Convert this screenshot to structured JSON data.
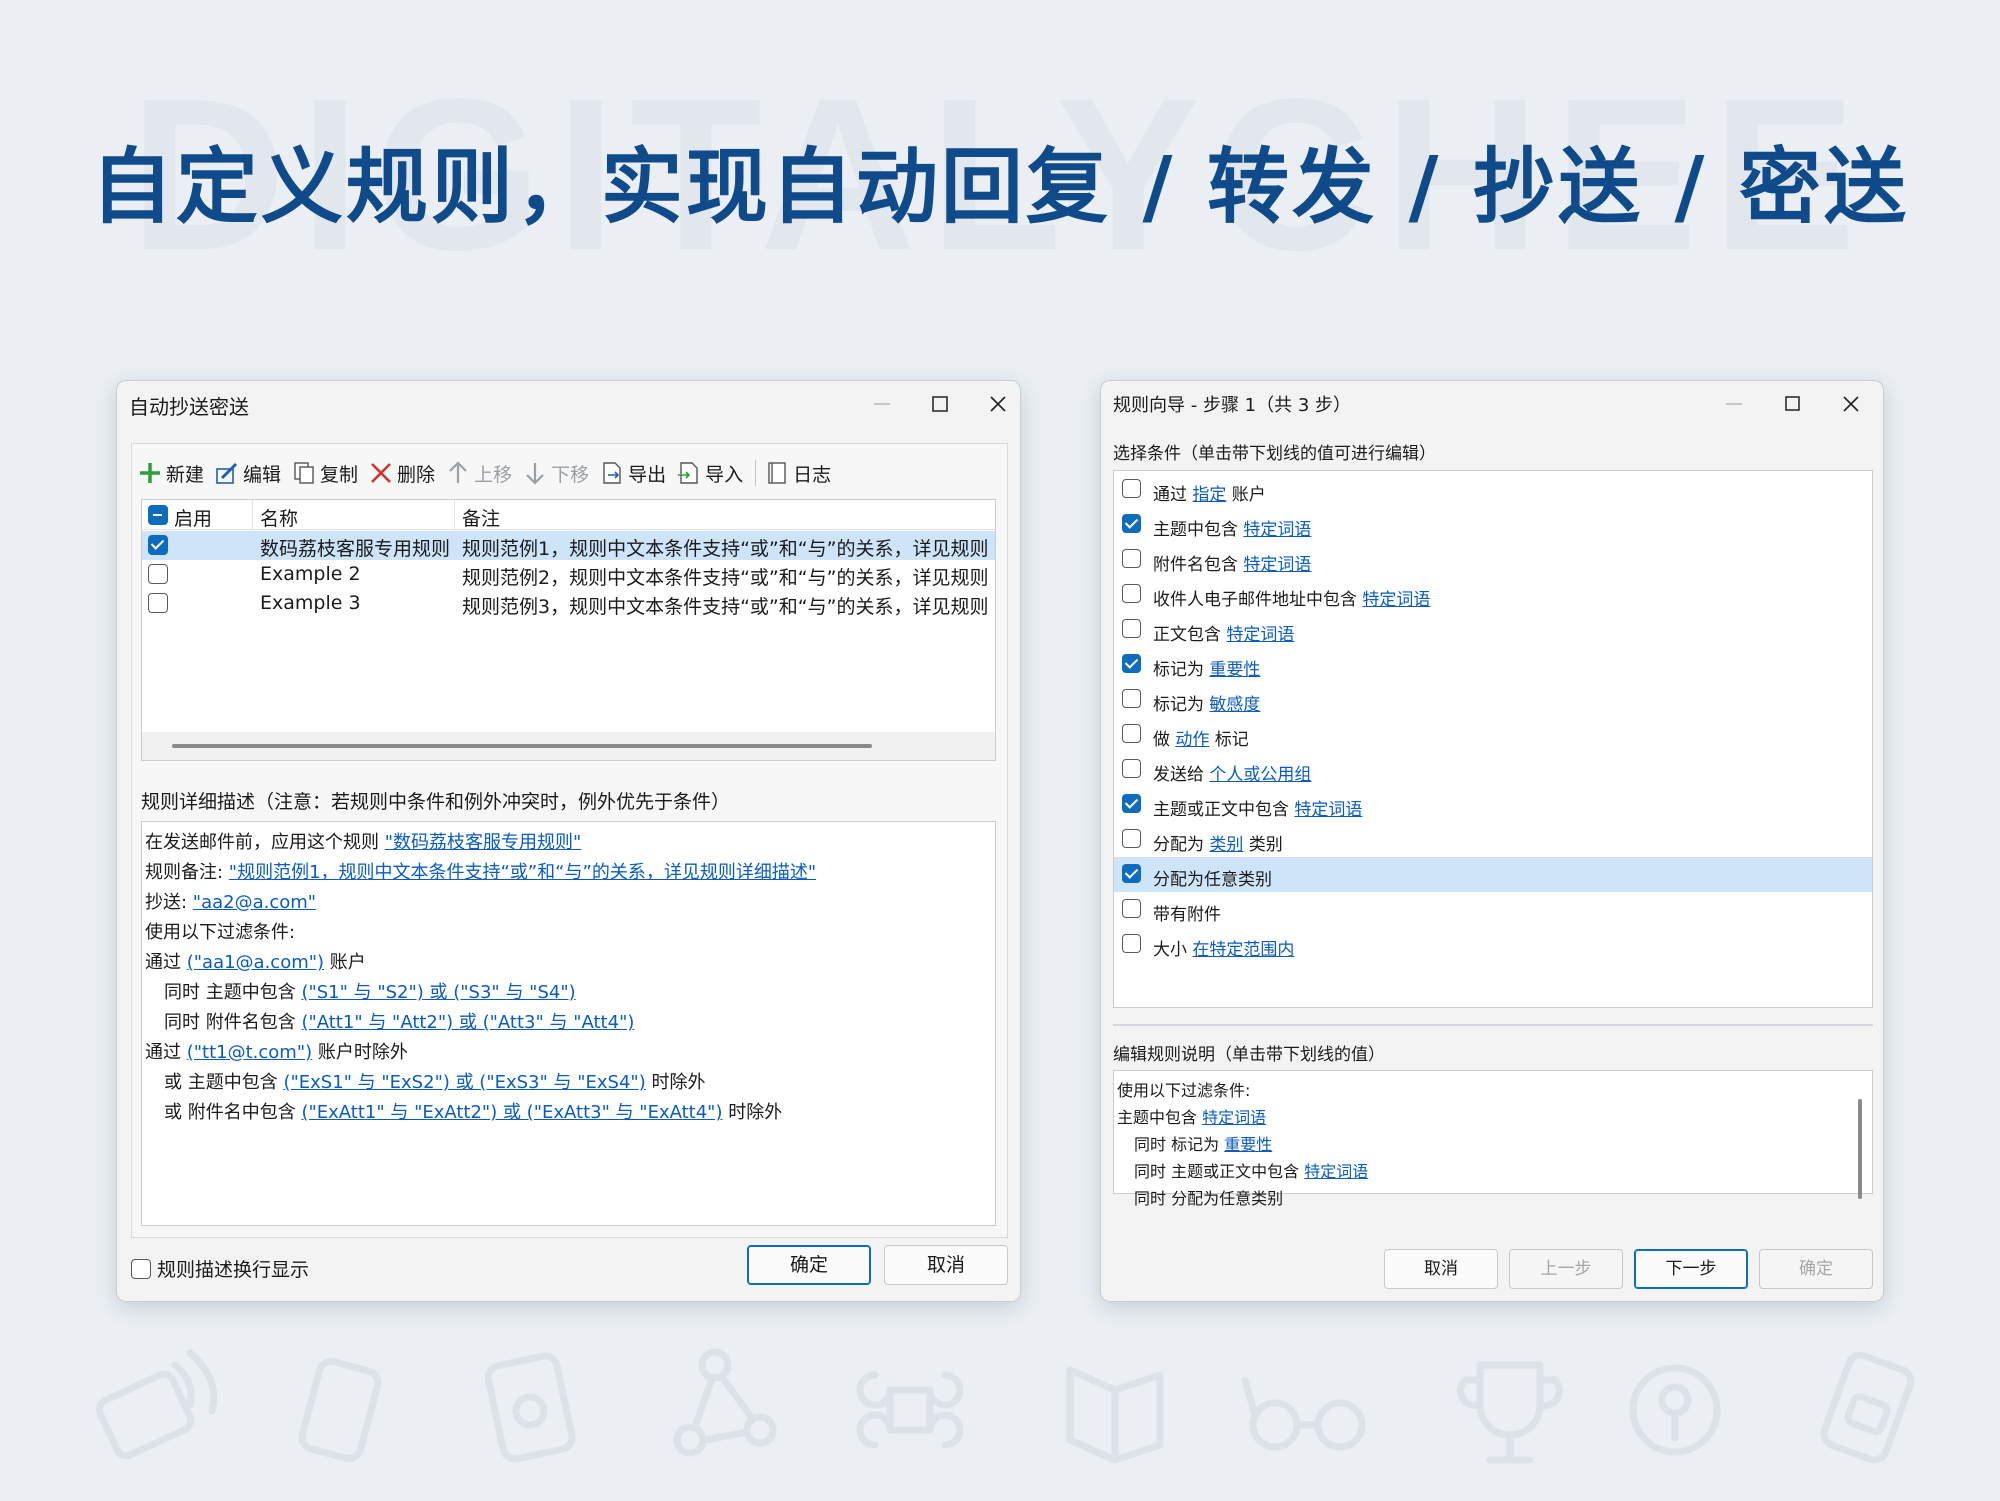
{
  "banner": {
    "watermark": "DIGITALYCHEE",
    "headline": "自定义规则，实现自动回复 / 转发 / 抄送 / 密送"
  },
  "left_window": {
    "title": "自动抄送密送",
    "toolbar": {
      "new": "新建",
      "edit": "编辑",
      "copy": "复制",
      "delete": "删除",
      "up": "上移",
      "down": "下移",
      "export": "导出",
      "import": "导入",
      "log": "日志"
    },
    "grid": {
      "columns": [
        "启用",
        "名称",
        "备注"
      ],
      "rows": [
        {
          "enabled": true,
          "name": "数码荔枝客服专用规则",
          "note": "规则范例1，规则中文本条件支持“或”和“与”的关系，详见规则"
        },
        {
          "enabled": false,
          "name": "Example 2",
          "note": "规则范例2，规则中文本条件支持“或”和“与”的关系，详见规则"
        },
        {
          "enabled": false,
          "name": "Example 3",
          "note": "规则范例3，规则中文本条件支持“或”和“与”的关系，详见规则"
        }
      ]
    },
    "description_label": "规则详细描述（注意：若规则中条件和例外冲突时，例外优先于条件）",
    "description": {
      "l1_text": "在发送邮件前，应用这个规则 ",
      "l1_link": "\"数码荔枝客服专用规则\"",
      "l2_text": "规则备注: ",
      "l2_link": "\"规则范例1，规则中文本条件支持“或”和“与”的关系，详见规则详细描述\"",
      "l3_text": "抄送: ",
      "l3_link": "\"aa2@a.com\"",
      "l4_text": "使用以下过滤条件:",
      "l5_pre": "通过 ",
      "l5_link": "(\"aa1@a.com\")",
      "l5_post": " 账户",
      "l6_pre": "同时 主题中包含 ",
      "l6_link": "(\"S1\" 与 \"S2\") 或 (\"S3\" 与 \"S4\")",
      "l7_pre": "同时 附件名包含 ",
      "l7_link": "(\"Att1\" 与 \"Att2\") 或 (\"Att3\" 与 \"Att4\")",
      "l8_pre": "通过 ",
      "l8_link": "(\"tt1@t.com\")",
      "l8_post": " 账户时除外",
      "l9_pre": "或 主题中包含 ",
      "l9_link": "(\"ExS1\" 与 \"ExS2\") 或 (\"ExS3\" 与 \"ExS4\")",
      "l9_post": " 时除外",
      "l10_pre": "或 附件名中包含 ",
      "l10_link": "(\"ExAtt1\" 与 \"ExAtt2\") 或 (\"ExAtt3\" 与 \"ExAtt4\")",
      "l10_post": " 时除外"
    },
    "wrap_label": "规则描述换行显示",
    "wrap_checked": false,
    "ok": "确定",
    "cancel": "取消"
  },
  "right_window": {
    "title": "规则向导 - 步骤 1（共 3 步）",
    "conditions_label": "选择条件（单击带下划线的值可进行编辑）",
    "conditions": [
      {
        "checked": false,
        "pre": "通过 ",
        "link": "指定",
        "post": " 账户"
      },
      {
        "checked": true,
        "pre": "主题中包含 ",
        "link": "特定词语",
        "post": ""
      },
      {
        "checked": false,
        "pre": "附件名包含 ",
        "link": "特定词语",
        "post": ""
      },
      {
        "checked": false,
        "pre": "收件人电子邮件地址中包含 ",
        "link": "特定词语",
        "post": ""
      },
      {
        "checked": false,
        "pre": "正文包含 ",
        "link": "特定词语",
        "post": ""
      },
      {
        "checked": true,
        "pre": "标记为 ",
        "link": "重要性",
        "post": ""
      },
      {
        "checked": false,
        "pre": "标记为 ",
        "link": "敏感度",
        "post": ""
      },
      {
        "checked": false,
        "pre": "做 ",
        "link": "动作",
        "post": " 标记"
      },
      {
        "checked": false,
        "pre": "发送给 ",
        "link": "个人或公用组",
        "post": ""
      },
      {
        "checked": true,
        "pre": "主题或正文中包含 ",
        "link": "特定词语",
        "post": ""
      },
      {
        "checked": false,
        "pre": "分配为 ",
        "link": "类别",
        "post": " 类别"
      },
      {
        "checked": true,
        "pre": "分配为任意类别",
        "link": "",
        "post": "",
        "selected": true
      },
      {
        "checked": false,
        "pre": "带有附件",
        "link": "",
        "post": ""
      },
      {
        "checked": false,
        "pre": "大小 ",
        "link": "在特定范围内",
        "post": ""
      }
    ],
    "edit_label": "编辑规则说明（单击带下划线的值）",
    "edit": {
      "e1": "使用以下过滤条件:",
      "e2_pre": "主题中包含 ",
      "e2_link": "特定词语",
      "e3_pre": "同时 标记为 ",
      "e3_link": "重要性",
      "e4_pre": "同时 主题或正文中包含 ",
      "e4_link": "特定词语",
      "e5": "同时 分配为任意类别"
    },
    "buttons": {
      "cancel": "取消",
      "prev": "上一步",
      "next": "下一步",
      "ok": "确定"
    }
  },
  "colors": {
    "accent": "#0f6cbd",
    "link": "#0a5cc0",
    "selection": "#cde4f9",
    "headline": "#0f4a8a"
  }
}
